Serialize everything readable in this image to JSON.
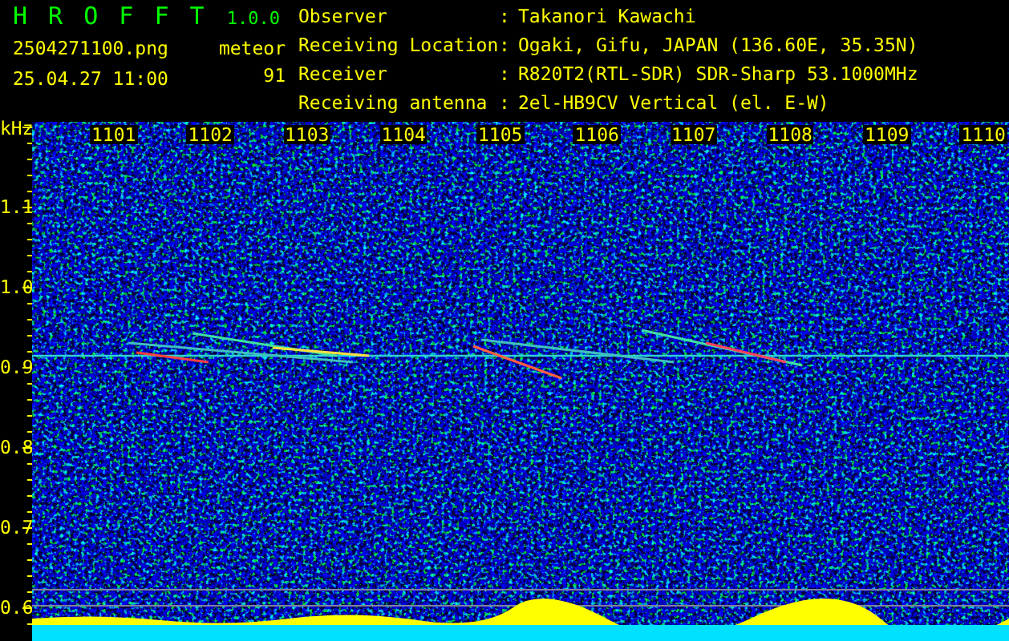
{
  "app": {
    "title": "H R O F F T",
    "version": "1.0.0",
    "file": "2504271100.png",
    "datetime": "25.04.27 11:00",
    "meteor_label": "meteor",
    "meteor_count": "91"
  },
  "info": [
    {
      "label": "Observer",
      "separator": ":",
      "value": "Takanori Kawachi"
    },
    {
      "label": "Receiving Location",
      "separator": ":",
      "value": "Ogaki, Gifu, JAPAN (136.60E, 35.35N)"
    },
    {
      "label": "Receiver",
      "separator": ":",
      "value": "R820T2(RTL-SDR) SDR-Sharp 53.1000MHz"
    },
    {
      "label": "Receiving antenna",
      "separator": ":",
      "value": "2el-HB9CV Vertical (el. E-W)"
    }
  ],
  "spectrogram": {
    "y_unit": "kHz",
    "y_labels": [
      "1.1",
      "1.0",
      "0.9",
      "0.8",
      "0.7",
      "0.6"
    ],
    "x_labels": [
      "1101",
      "1102",
      "1103",
      "1104",
      "1105",
      "1106",
      "1107",
      "1108",
      "1109",
      "1110"
    ]
  }
}
